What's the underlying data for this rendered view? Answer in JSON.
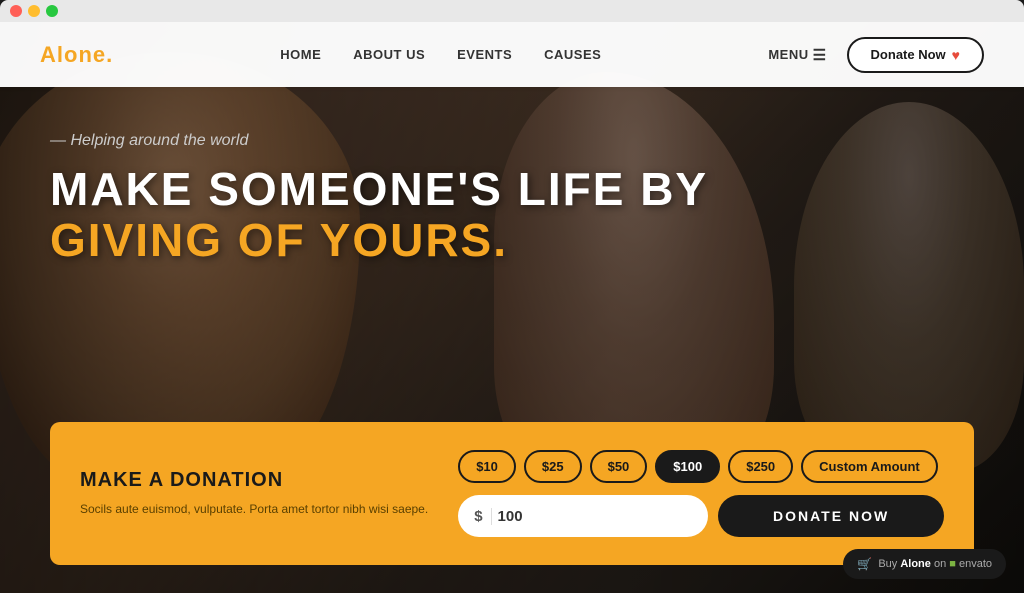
{
  "window": {
    "dots": [
      "red",
      "yellow",
      "green"
    ]
  },
  "navbar": {
    "logo": "Alone",
    "logo_dot": ".",
    "links": [
      {
        "label": "HOME",
        "id": "home"
      },
      {
        "label": "ABOUT US",
        "id": "about"
      },
      {
        "label": "EVENTS",
        "id": "events"
      },
      {
        "label": "CAUSES",
        "id": "causes"
      }
    ],
    "menu_label": "MENU",
    "donate_label": "Donate Now"
  },
  "hero": {
    "tagline": "— Helping around the world",
    "title_line1": "MAKE SOMEONE'S LIFE BY",
    "title_line2": "GIVING OF YOURS."
  },
  "donation": {
    "title": "MAKE A DONATION",
    "description": "Socils aute euismod, vulputate. Porta amet tortor nibh wisi saepe.",
    "amounts": [
      {
        "value": "$10",
        "id": "amt10",
        "active": false
      },
      {
        "value": "$25",
        "id": "amt25",
        "active": false
      },
      {
        "value": "$50",
        "id": "amt50",
        "active": false
      },
      {
        "value": "$100",
        "id": "amt100",
        "active": true
      },
      {
        "value": "$250",
        "id": "amt250",
        "active": false
      },
      {
        "value": "Custom Amount",
        "id": "amtcustom",
        "active": false
      }
    ],
    "dollar_sign": "$",
    "input_value": "100",
    "input_placeholder": "100",
    "donate_button": "DONATE NOW"
  },
  "envato": {
    "text": "Buy ",
    "brand": "Alone",
    "suffix": " on  envato"
  },
  "colors": {
    "accent": "#f5a623",
    "dark": "#1a1a1a",
    "gold_text": "#f5a623",
    "white": "#ffffff"
  }
}
